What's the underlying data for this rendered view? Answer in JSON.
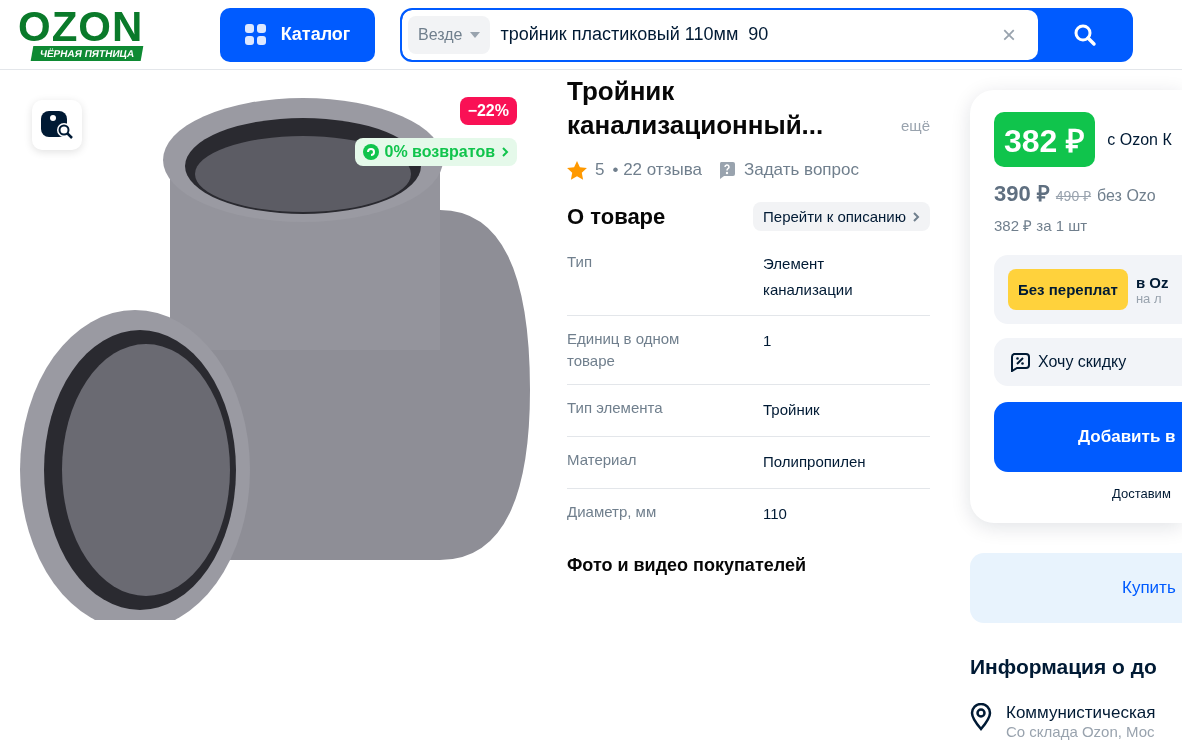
{
  "header": {
    "logo": "OZON",
    "logo_tagline": "ЧЁРНАЯ ПЯТНИЦА",
    "catalog_button": "Каталог",
    "search": {
      "scope": "Везде",
      "value": "тройник пластиковый 110мм  90",
      "clear": "×"
    }
  },
  "gallery": {
    "discount_badge": "−22%",
    "returns_badge": "0% возвратов"
  },
  "product": {
    "title": "Тройник канализационный...",
    "more_link": "ещё",
    "rating": "5",
    "reviews": "• 22 отзыва",
    "ask_question": "Задать вопрос",
    "about_heading": "О товаре",
    "to_description": "Перейти к описанию",
    "specs": [
      {
        "label": "Тип",
        "value": "Элемент канализации"
      },
      {
        "label": "Единиц в одном товаре",
        "value": "1"
      },
      {
        "label": "Тип элемента",
        "value": "Тройник"
      },
      {
        "label": "Материал",
        "value": "Полипропилен"
      },
      {
        "label": "Диаметр, мм",
        "value": "110"
      }
    ],
    "media_heading": "Фото и видео покупателей"
  },
  "buy_card": {
    "card_price": "382 ₽",
    "card_price_note": "с Ozon К",
    "price": "390 ₽",
    "old_price": "490 ₽",
    "price_note": "без Ozo",
    "unit_price": "382 ₽ за 1 шт",
    "no_overpay_badge": "Без переплат",
    "no_overpay_text": "в Oz",
    "no_overpay_sub": "на л",
    "discount_request": "Хочу скидку",
    "add_to_cart": "Добавить в",
    "delivery_note": "Доставим"
  },
  "buy_now": "Купить",
  "delivery_info": {
    "heading": "Информация о до",
    "address": "Коммунистическая",
    "warehouse": "Со склада Ozon, Мос"
  }
}
